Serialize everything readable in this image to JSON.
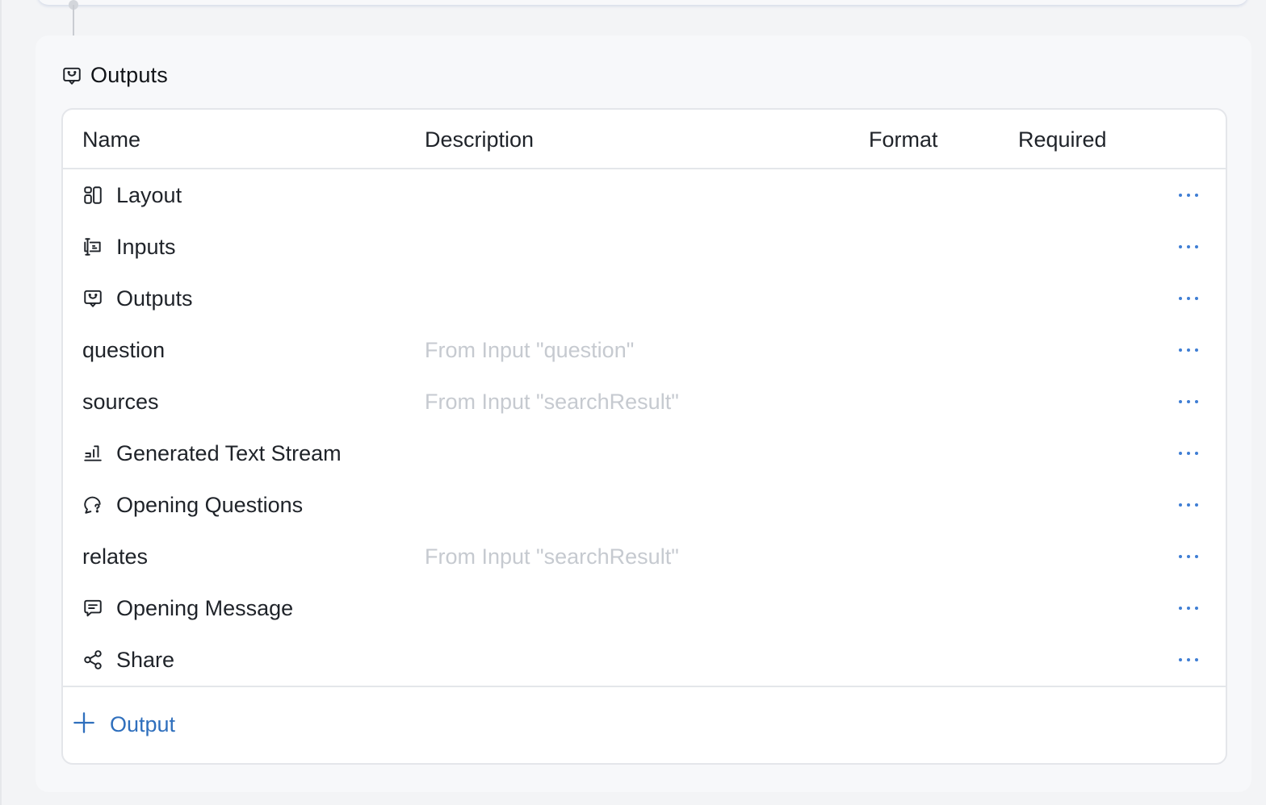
{
  "node": {
    "title": "Outputs",
    "icon": "outputs-icon"
  },
  "table": {
    "columns": {
      "name": "Name",
      "description": "Description",
      "format": "Format",
      "required": "Required"
    },
    "rows": [
      {
        "name": "Layout",
        "icon": "layout-icon",
        "description": ""
      },
      {
        "name": "Inputs",
        "icon": "inputs-icon",
        "description": ""
      },
      {
        "name": "Outputs",
        "icon": "outputs-icon",
        "description": ""
      },
      {
        "name": "question",
        "icon": "",
        "description": "From Input \"question\""
      },
      {
        "name": "sources",
        "icon": "",
        "description": "From Input \"searchResult\""
      },
      {
        "name": "Generated Text Stream",
        "icon": "text-stream-icon",
        "description": ""
      },
      {
        "name": "Opening Questions",
        "icon": "question-bubble-icon",
        "description": ""
      },
      {
        "name": "relates",
        "icon": "",
        "description": "From Input \"searchResult\""
      },
      {
        "name": "Opening Message",
        "icon": "message-icon",
        "description": ""
      },
      {
        "name": "Share",
        "icon": "share-icon",
        "description": ""
      }
    ]
  },
  "footer": {
    "add_label": "Output"
  },
  "colors": {
    "accent": "#2f6fbd",
    "more_dots": "#3f7ed4",
    "placeholder_text": "#c6cad0",
    "border": "#e4e6ea",
    "node_bg": "#f7f8fa"
  }
}
